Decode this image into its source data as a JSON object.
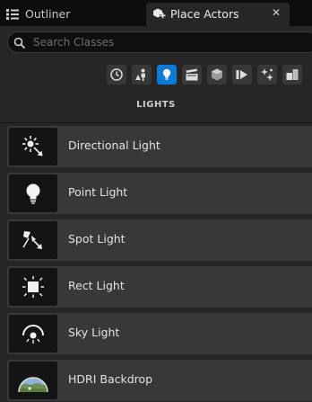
{
  "tabs": {
    "outliner": {
      "label": "Outliner",
      "icon": "outliner-icon"
    },
    "place_actors": {
      "label": "Place Actors",
      "icon": "place-actors-icon",
      "close": "✕"
    }
  },
  "search": {
    "placeholder": "Search Classes",
    "value": ""
  },
  "categories": [
    {
      "name": "recently-placed",
      "icon": "clock-icon",
      "active": false
    },
    {
      "name": "basic",
      "icon": "shapes-person-icon",
      "active": false
    },
    {
      "name": "lights",
      "icon": "lightbulb-icon",
      "active": true
    },
    {
      "name": "cinematic",
      "icon": "clapperboard-icon",
      "active": false
    },
    {
      "name": "visual-effects",
      "icon": "cube-icon",
      "active": false
    },
    {
      "name": "volumes",
      "icon": "volume-icon",
      "active": false
    },
    {
      "name": "all-classes",
      "icon": "sparkle-icon",
      "active": false
    },
    {
      "name": "geometry",
      "icon": "boxes-icon",
      "active": false
    }
  ],
  "section_title": "LIGHTS",
  "items": [
    {
      "label": "Directional Light",
      "icon": "directional-light-icon"
    },
    {
      "label": "Point Light",
      "icon": "point-light-icon"
    },
    {
      "label": "Spot Light",
      "icon": "spot-light-icon"
    },
    {
      "label": "Rect Light",
      "icon": "rect-light-icon"
    },
    {
      "label": "Sky Light",
      "icon": "sky-light-icon"
    },
    {
      "label": "HDRI Backdrop",
      "icon": "hdri-backdrop-icon"
    }
  ],
  "colors": {
    "accent": "#0e7ad8",
    "panel": "#262626",
    "item": "#383838"
  }
}
